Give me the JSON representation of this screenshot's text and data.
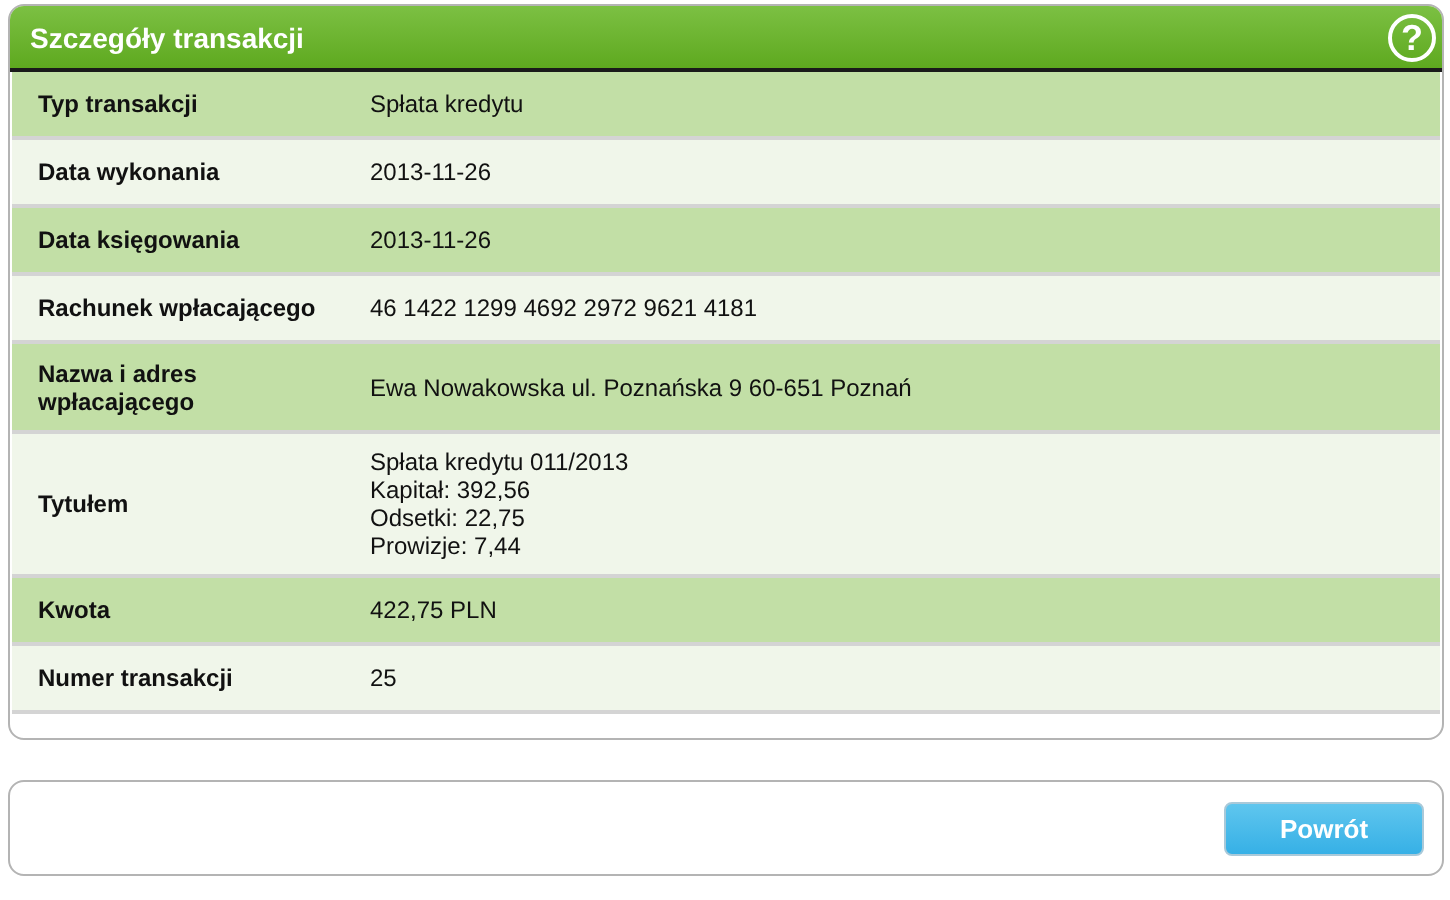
{
  "panel": {
    "title": "Szczegóły transakcji",
    "help_icon": "?"
  },
  "rows": [
    {
      "label": "Typ transakcji",
      "lines": [
        "Spłata kredytu"
      ]
    },
    {
      "label": "Data wykonania",
      "lines": [
        "2013-11-26"
      ]
    },
    {
      "label": "Data księgowania",
      "lines": [
        "2013-11-26"
      ]
    },
    {
      "label": "Rachunek wpłacającego",
      "lines": [
        "46 1422 1299 4692 2972 9621 4181"
      ]
    },
    {
      "label": "Nazwa i adres wpłacającego",
      "lines": [
        "Ewa Nowakowska ul. Poznańska 9 60-651 Poznań"
      ]
    },
    {
      "label": "Tytułem",
      "lines": [
        "Spłata kredytu 011/2013",
        "Kapitał: 392,56",
        "Odsetki: 22,75",
        "Prowizje: 7,44"
      ]
    },
    {
      "label": "Kwota",
      "lines": [
        "422,75 PLN"
      ]
    },
    {
      "label": "Numer transakcji",
      "lines": [
        "25"
      ]
    }
  ],
  "buttons": [
    "Powrót"
  ]
}
